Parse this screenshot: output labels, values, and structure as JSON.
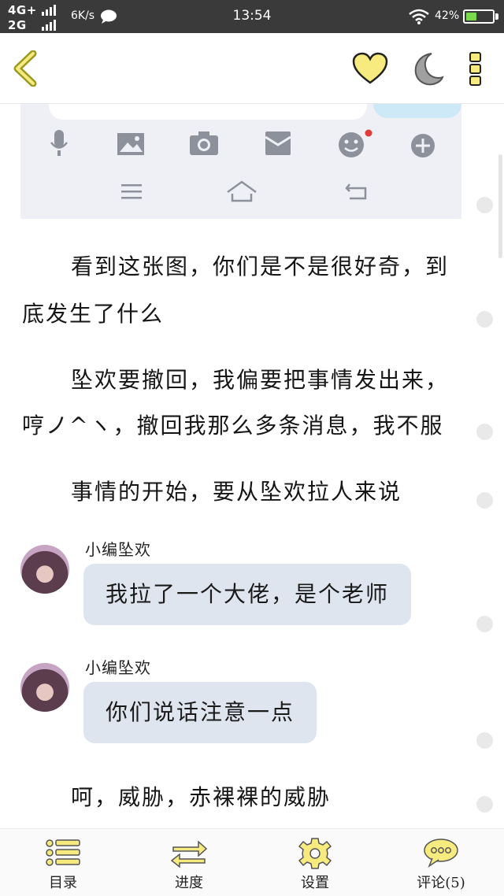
{
  "status": {
    "network_top": "4G+",
    "network_bottom": "2G",
    "speed": "6K/s",
    "time": "13:54",
    "battery_text": "42%",
    "battery_level": 0.42
  },
  "colors": {
    "accent_yellow": "#f7ea7e",
    "icon_outline": "#8a8a1f",
    "bubble_bg": "#dfe5ee",
    "notification_dot": "#e23b3b"
  },
  "appbar": {
    "icons": [
      "back-icon",
      "heart-icon",
      "moon-icon",
      "more-icon"
    ]
  },
  "content": {
    "p1_line1": "看到这张图，你们是不是很好奇，到",
    "p1_line2": "底发生了什么",
    "p2_line1": "坠欢要撤回，我偏要把事情发出来，",
    "p2_line2": "哼ノ^ヽ，撤回我那么多条消息，我不服",
    "p3": "事情的开始，要从坠欢拉人来说",
    "chats": [
      {
        "sender": "小编坠欢",
        "message": "我拉了一个大佬，是个老师"
      },
      {
        "sender": "小编坠欢",
        "message": "你们说话注意一点"
      }
    ],
    "p4": "呵，威胁，赤裸裸的威胁"
  },
  "bottom_nav": [
    {
      "label": "目录",
      "icon": "catalog-icon"
    },
    {
      "label": "进度",
      "icon": "progress-icon"
    },
    {
      "label": "设置",
      "icon": "gear-icon"
    },
    {
      "label": "评论(5)",
      "icon": "comment-icon"
    }
  ]
}
